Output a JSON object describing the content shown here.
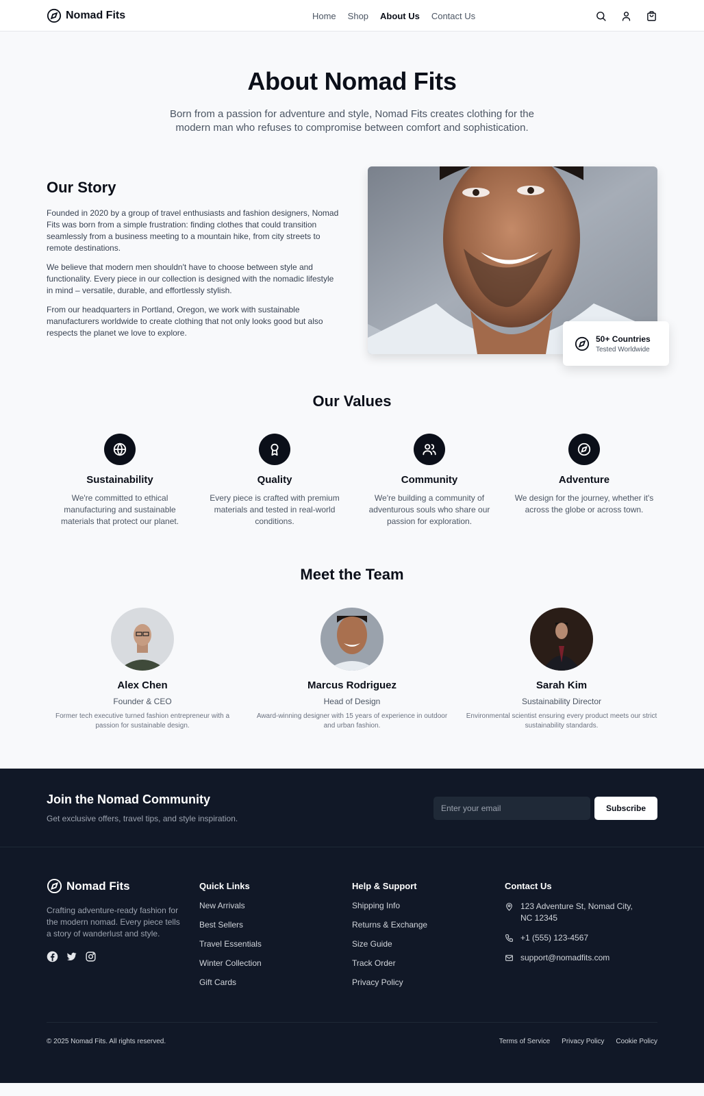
{
  "nav": {
    "brand": "Nomad Fits",
    "links": [
      "Home",
      "Shop",
      "About Us",
      "Contact Us"
    ],
    "active": "About Us",
    "icons": [
      "search-icon",
      "user-icon",
      "cart-icon"
    ]
  },
  "hero": {
    "title": "About Nomad Fits",
    "subtitle": "Born from a passion for adventure and style, Nomad Fits creates clothing for the modern man who refuses to compromise between comfort and sophistication."
  },
  "story": {
    "title": "Our Story",
    "paragraphs": [
      "Founded in 2020 by a group of travel enthusiasts and fashion designers, Nomad Fits was born from a simple frustration: finding clothes that could transition seamlessly from a business meeting to a mountain hike, from city streets to remote destinations.",
      "We believe that modern men shouldn't have to choose between style and functionality. Every piece in our collection is designed with the nomadic lifestyle in mind – versatile, durable, and effortlessly stylish.",
      "From our headquarters in Portland, Oregon, we work with sustainable manufacturers worldwide to create clothing that not only looks good but also respects the planet we love to explore."
    ],
    "stat": {
      "title": "50+ Countries",
      "subtitle": "Tested Worldwide",
      "icon": "compass-icon"
    }
  },
  "values": {
    "title": "Our Values",
    "items": [
      {
        "icon": "globe-icon",
        "title": "Sustainability",
        "text": "We're committed to ethical manufacturing and sustainable materials that protect our planet."
      },
      {
        "icon": "award-icon",
        "title": "Quality",
        "text": "Every piece is crafted with premium materials and tested in real-world conditions."
      },
      {
        "icon": "users-icon",
        "title": "Community",
        "text": "We're building a community of adventurous souls who share our passion for exploration."
      },
      {
        "icon": "compass-icon",
        "title": "Adventure",
        "text": "We design for the journey, whether it's across the globe or across town."
      }
    ]
  },
  "team": {
    "title": "Meet the Team",
    "members": [
      {
        "name": "Alex Chen",
        "role": "Founder & CEO",
        "bio": "Former tech executive turned fashion entrepreneur with a passion for sustainable design."
      },
      {
        "name": "Marcus Rodriguez",
        "role": "Head of Design",
        "bio": "Award-winning designer with 15 years of experience in outdoor and urban fashion."
      },
      {
        "name": "Sarah Kim",
        "role": "Sustainability Director",
        "bio": "Environmental scientist ensuring every product meets our strict sustainability standards."
      }
    ]
  },
  "newsletter": {
    "title": "Join the Nomad Community",
    "subtitle": "Get exclusive offers, travel tips, and style inspiration.",
    "placeholder": "Enter your email",
    "button": "Subscribe"
  },
  "footer": {
    "brand": "Nomad Fits",
    "description": "Crafting adventure-ready fashion for the modern nomad. Every piece tells a story of wanderlust and style.",
    "socials": [
      "facebook-icon",
      "twitter-icon",
      "instagram-icon"
    ],
    "quick_links": {
      "title": "Quick Links",
      "items": [
        "New Arrivals",
        "Best Sellers",
        "Travel Essentials",
        "Winter Collection",
        "Gift Cards"
      ]
    },
    "help": {
      "title": "Help & Support",
      "items": [
        "Shipping Info",
        "Returns & Exchange",
        "Size Guide",
        "Track Order",
        "Privacy Policy"
      ]
    },
    "contact": {
      "title": "Contact Us",
      "address": "123 Adventure St, Nomad City, NC 12345",
      "phone": "+1 (555) 123-4567",
      "email": "support@nomadfits.com"
    },
    "copyright": "© 2025 Nomad Fits. All rights reserved.",
    "legal": [
      "Terms of Service",
      "Privacy Policy",
      "Cookie Policy"
    ]
  },
  "colors": {
    "primary": "#0b0f19",
    "background": "#f8f9fb",
    "footer": "#111827",
    "muted": "#4b5563"
  }
}
